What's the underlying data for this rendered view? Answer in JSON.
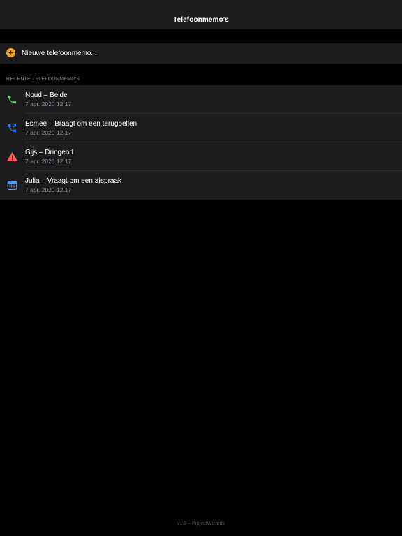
{
  "navbar": {
    "title": "Telefoonmemo's"
  },
  "new_memo": {
    "label": "Nieuwe telefoonmemo...",
    "icon": "plus-circle-icon",
    "color": "#f5a623"
  },
  "section": {
    "header": "RECENTE TELEFOONMEMO'S"
  },
  "memos": [
    {
      "title": "Noud – Belde",
      "date": "7 apr. 2020 12:17",
      "icon": "phone-icon",
      "color": "#4cd964"
    },
    {
      "title": "Esmee – Braagt om een terugbellen",
      "date": "7 apr. 2020 12:17",
      "icon": "phone-callback-icon",
      "color": "#3478f6"
    },
    {
      "title": "Gijs – Dringend",
      "date": "7 apr. 2020 12:17",
      "icon": "warning-icon",
      "color": "#ff5a5f"
    },
    {
      "title": "Julia – Vraagt om een afspraak",
      "date": "7 apr. 2020 12:17",
      "icon": "calendar-icon",
      "color": "#4a9eff"
    }
  ],
  "footer": {
    "text": "v1.0 – ProjectWizards"
  }
}
